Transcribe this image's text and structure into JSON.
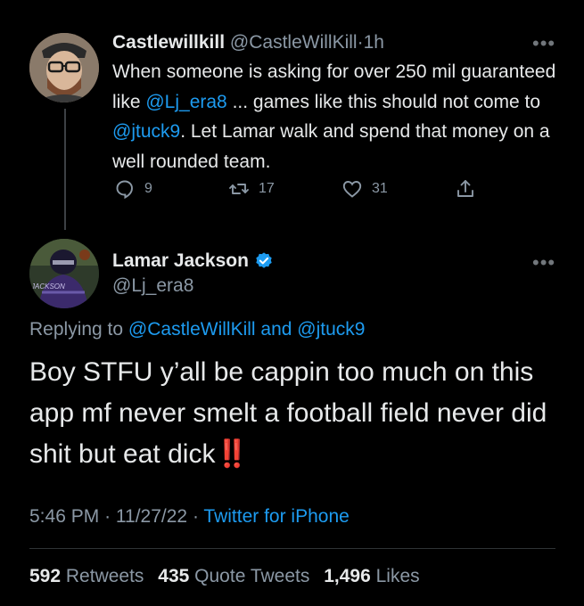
{
  "parent_tweet": {
    "display_name": "Castlewillkill",
    "handle": "@CastleWillKill",
    "separator": "·",
    "time": "1h",
    "text_before": "When someone is asking for over 250 mil guaranteed like ",
    "mention_1": "@Lj_era8",
    "text_middle": " ... games like this should not come to ",
    "mention_2": "@jtuck9",
    "text_after": ". Let Lamar walk and spend that money on a well rounded team.",
    "reply_count": "9",
    "retweet_count": "17",
    "like_count": "31",
    "more_icon": "more-horizontal-icon"
  },
  "main_tweet": {
    "display_name": "Lamar Jackson",
    "verified_icon": "verified-badge-icon",
    "handle": "@Lj_era8",
    "replying_prefix": "Replying to ",
    "replying_user_1": "@CastleWillKill",
    "replying_and": " and ",
    "replying_user_2": "@jtuck9",
    "text": "Boy STFU y’all be cappin too much on this app mf never smelt a football field never did shit but eat dick",
    "emoji": "‼️",
    "time": "5:46 PM",
    "date": "11/27/22",
    "separator": "·",
    "source": "Twitter for iPhone",
    "jersey_text": "JACKSON"
  },
  "stats": {
    "retweets_count": "592",
    "retweets_label": "Retweets",
    "quote_count": "435",
    "quote_label": "Quote Tweets",
    "likes_count": "1,496",
    "likes_label": "Likes"
  },
  "colors": {
    "background": "#000000",
    "text": "#e7e9ea",
    "secondary": "#8b98a5",
    "link": "#1d9bf0",
    "verified": "#1d9bf0",
    "emoji_red": "#e0245e"
  }
}
